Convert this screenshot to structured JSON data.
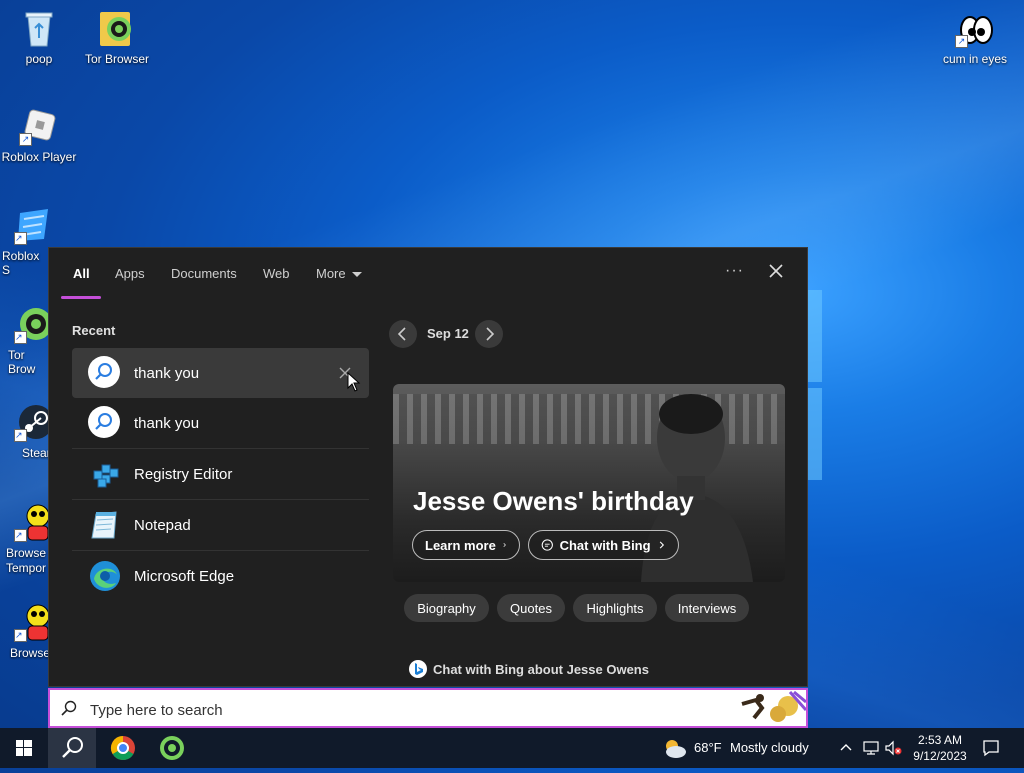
{
  "desktop": {
    "icons": [
      {
        "label": "poop"
      },
      {
        "label": "Tor Browser"
      },
      {
        "label": "cum in eyes"
      },
      {
        "label": "Roblox Player"
      },
      {
        "label": "Roblox S"
      },
      {
        "label": "Tor Brow"
      },
      {
        "label": "Stean"
      },
      {
        "label": "Browse Tempor"
      },
      {
        "label": "Browse"
      }
    ]
  },
  "search_panel": {
    "tabs": [
      {
        "label": "All"
      },
      {
        "label": "Apps"
      },
      {
        "label": "Documents"
      },
      {
        "label": "Web"
      },
      {
        "label": "More"
      }
    ],
    "options_label": "···",
    "recent": {
      "title": "Recent",
      "items": [
        {
          "label": "thank you",
          "icon": "search-icon"
        },
        {
          "label": "thank you",
          "icon": "search-icon"
        },
        {
          "label": "Registry Editor",
          "icon": "registry-editor-icon"
        },
        {
          "label": "Notepad",
          "icon": "notepad-icon"
        },
        {
          "label": "Microsoft Edge",
          "icon": "edge-icon"
        }
      ]
    },
    "highlight": {
      "date": "Sep 12",
      "title": "Jesse Owens' birthday",
      "learn_more": "Learn more",
      "chat_with_bing": "Chat with Bing",
      "chips": [
        {
          "label": "Biography"
        },
        {
          "label": "Quotes"
        },
        {
          "label": "Highlights"
        },
        {
          "label": "Interviews"
        }
      ],
      "bing_line": "Chat with Bing about Jesse Owens"
    }
  },
  "searchbox": {
    "placeholder": "Type here to search"
  },
  "taskbar": {
    "weather_temp": "68°F",
    "weather_desc": "Mostly cloudy",
    "time": "2:53 AM",
    "date": "9/12/2023"
  },
  "colors": {
    "accent": "#c54fd9",
    "panel_bg": "#202020"
  }
}
